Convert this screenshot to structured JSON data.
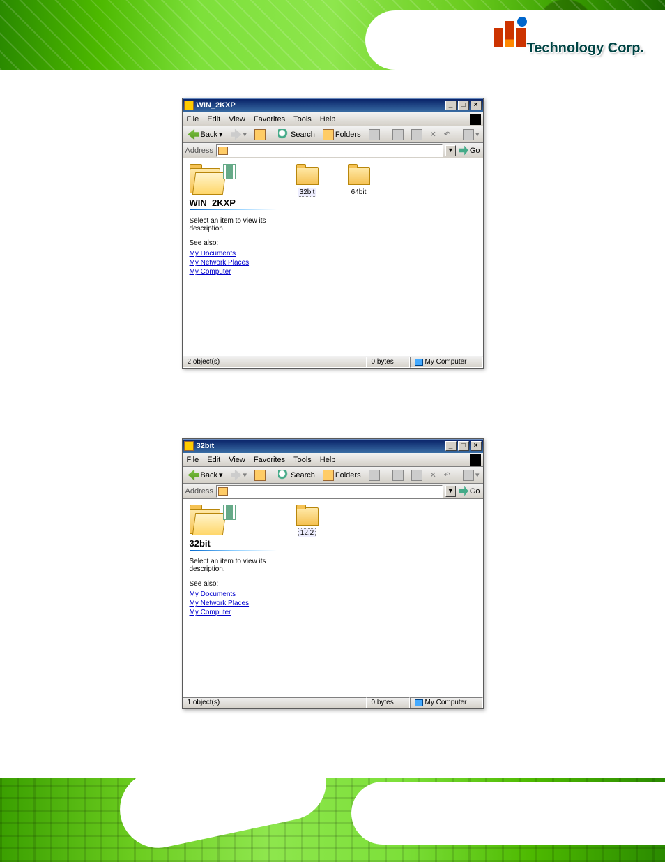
{
  "brand": "Technology Corp.",
  "menu": {
    "file": "File",
    "edit": "Edit",
    "view": "View",
    "favorites": "Favorites",
    "tools": "Tools",
    "help": "Help"
  },
  "toolbar": {
    "back": "Back",
    "search": "Search",
    "folders": "Folders"
  },
  "address_label": "Address",
  "go": "Go",
  "leftpanel": {
    "select_hint": "Select an item to view its description.",
    "see_also": "See also:",
    "links": {
      "mydocs": "My Documents",
      "netplaces": "My Network Places",
      "mycomp": "My Computer"
    }
  },
  "win1": {
    "title": "WIN_2KXP",
    "folder_name": "WIN_2KXP",
    "items": [
      {
        "name": "32bit",
        "selected": true
      },
      {
        "name": "64bit",
        "selected": false
      }
    ],
    "status": {
      "objects": "2 object(s)",
      "bytes": "0 bytes",
      "location": "My Computer"
    }
  },
  "win2": {
    "title": "32bit",
    "folder_name": "32bit",
    "items": [
      {
        "name": "12.2",
        "selected": true
      }
    ],
    "status": {
      "objects": "1 object(s)",
      "bytes": "0 bytes",
      "location": "My Computer"
    }
  }
}
